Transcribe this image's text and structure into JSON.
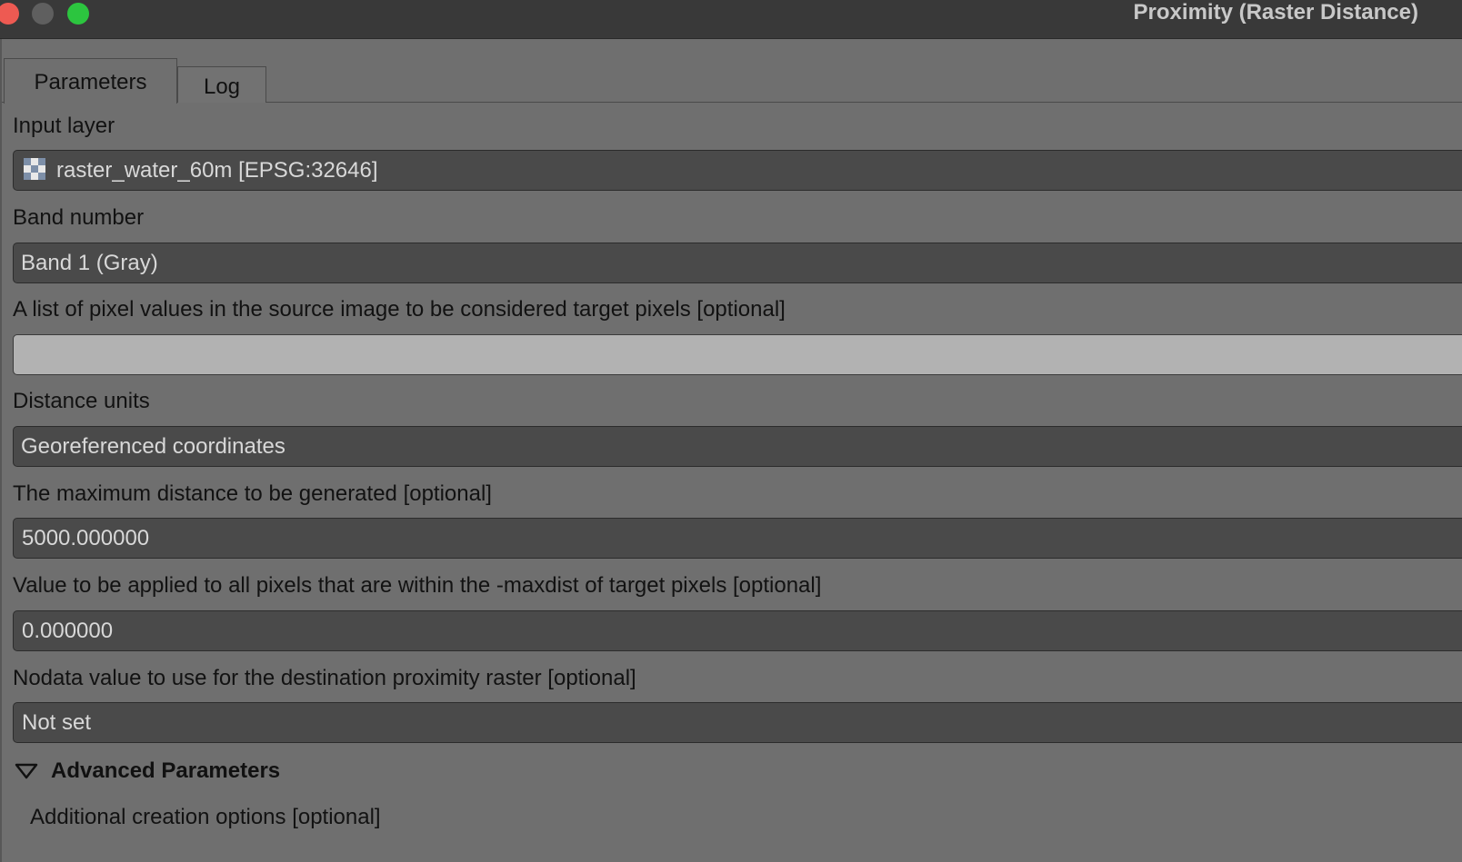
{
  "window": {
    "title": "Proximity (Raster Distance)"
  },
  "tabs": [
    {
      "label": "Parameters",
      "active": true
    },
    {
      "label": "Log",
      "active": false
    }
  ],
  "form": {
    "input_layer": {
      "label": "Input layer",
      "value": "raster_water_60m [EPSG:32646]",
      "icon": "raster-layer-icon"
    },
    "band_number": {
      "label": "Band number",
      "value": "Band 1 (Gray)"
    },
    "pixel_values": {
      "label": "A list of pixel values in the source image to be considered target pixels [optional]",
      "value": ""
    },
    "distance_units": {
      "label": "Distance units",
      "value": "Georeferenced coordinates"
    },
    "max_distance": {
      "label": "The maximum distance to be generated [optional]",
      "value": "5000.000000"
    },
    "replace_value": {
      "label": "Value to be applied to all pixels that are within the -maxdist of target pixels [optional]",
      "value": "0.000000"
    },
    "nodata": {
      "label": "Nodata value to use for the destination proximity raster [optional]",
      "value": "Not set"
    }
  },
  "advanced": {
    "title": "Advanced Parameters",
    "expanded": true,
    "creation_options_label": "Additional creation options [optional]"
  },
  "colors": {
    "close": "#ee5a52",
    "minimize": "#5f5f5f",
    "maximize": "#2cc53f",
    "panel": "#6f6f6f",
    "field": "#4a4a4a"
  }
}
